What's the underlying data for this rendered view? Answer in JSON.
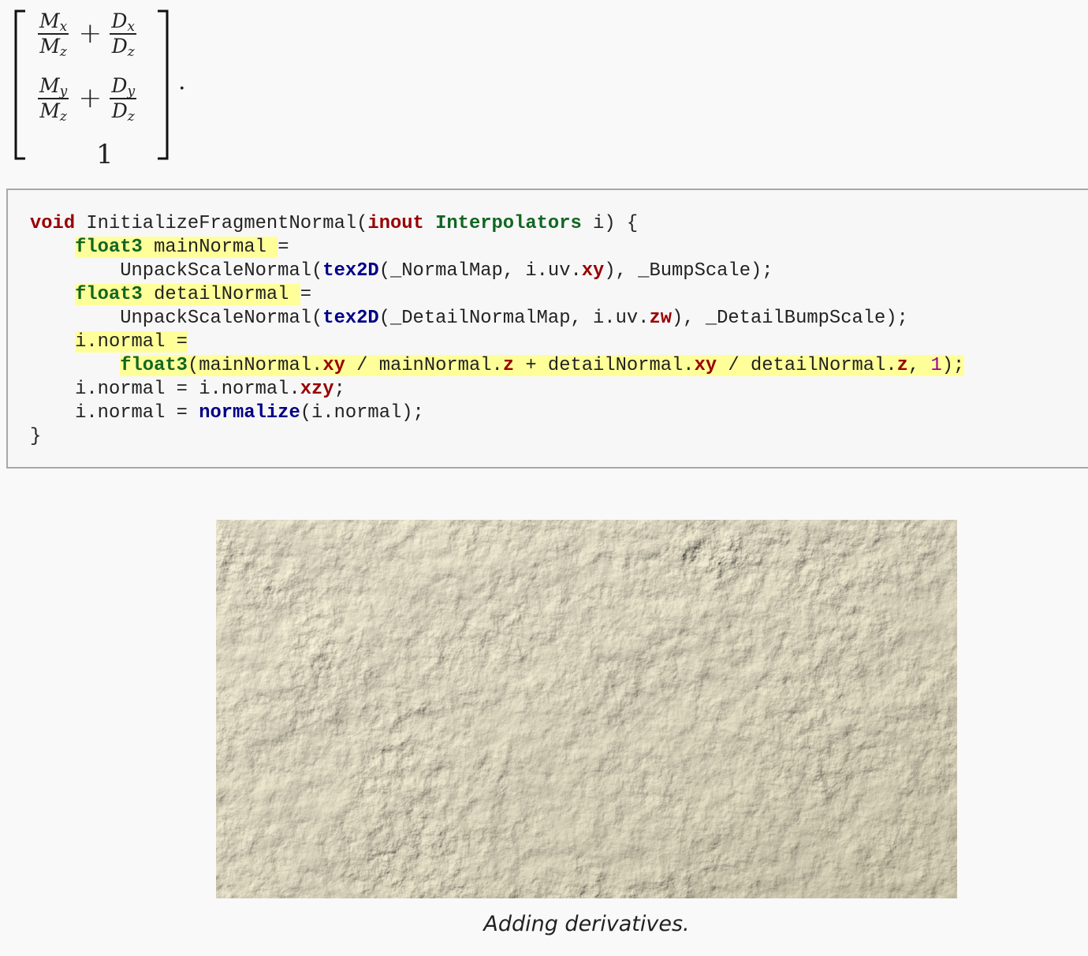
{
  "math": {
    "row1": {
      "n1": "M",
      "n1sub": "x",
      "d1": "M",
      "d1sub": "z",
      "op": "+",
      "n2": "D",
      "n2sub": "x",
      "d2": "D",
      "d2sub": "z"
    },
    "row2": {
      "n1": "M",
      "n1sub": "y",
      "d1": "M",
      "d1sub": "z",
      "op": "+",
      "n2": "D",
      "n2sub": "y",
      "d2": "D",
      "d2sub": "z"
    },
    "row3": "1",
    "terminator": "."
  },
  "code": {
    "lines": [
      [
        {
          "t": "void",
          "c": "kw"
        },
        {
          "t": " InitializeFragmentNormal("
        },
        {
          "t": "inout",
          "c": "kw"
        },
        {
          "t": " "
        },
        {
          "t": "Interpolators",
          "c": "ty"
        },
        {
          "t": " i) {"
        }
      ],
      [
        {
          "t": "    "
        },
        {
          "t": "float3",
          "c": "ty",
          "h": true
        },
        {
          "t": " mainNormal ",
          "h": true
        },
        {
          "t": "="
        }
      ],
      [
        {
          "t": "        UnpackScaleNormal("
        },
        {
          "t": "tex2D",
          "c": "fn"
        },
        {
          "t": "(_NormalMap, i.uv."
        },
        {
          "t": "xy",
          "c": "sw"
        },
        {
          "t": "), _BumpScale);"
        }
      ],
      [
        {
          "t": "    "
        },
        {
          "t": "float3",
          "c": "ty",
          "h": true
        },
        {
          "t": " detailNormal ",
          "h": true
        },
        {
          "t": "="
        }
      ],
      [
        {
          "t": "        UnpackScaleNormal("
        },
        {
          "t": "tex2D",
          "c": "fn"
        },
        {
          "t": "(_DetailNormalMap, i.uv."
        },
        {
          "t": "zw",
          "c": "sw"
        },
        {
          "t": "), _DetailBumpScale);"
        }
      ],
      [
        {
          "t": "    "
        },
        {
          "t": "i.normal =",
          "h": true
        }
      ],
      [
        {
          "t": "        "
        },
        {
          "t": "float3",
          "c": "ty",
          "h": true
        },
        {
          "t": "(mainNormal.",
          "h": true
        },
        {
          "t": "xy",
          "c": "sw",
          "h": true
        },
        {
          "t": " / mainNormal.",
          "h": true
        },
        {
          "t": "z",
          "c": "sw",
          "h": true
        },
        {
          "t": " + detailNormal.",
          "h": true
        },
        {
          "t": "xy",
          "c": "sw",
          "h": true
        },
        {
          "t": " / detailNormal.",
          "h": true
        },
        {
          "t": "z",
          "c": "sw",
          "h": true
        },
        {
          "t": ", ",
          "h": true
        },
        {
          "t": "1",
          "c": "nm",
          "h": true
        },
        {
          "t": ");",
          "h": true
        }
      ],
      [
        {
          "t": "    i.normal = i.normal."
        },
        {
          "t": "xzy",
          "c": "sw"
        },
        {
          "t": ";"
        }
      ],
      [
        {
          "t": "    i.normal = "
        },
        {
          "t": "normalize",
          "c": "fn"
        },
        {
          "t": "(i.normal);"
        }
      ],
      [
        {
          "t": "}"
        }
      ]
    ]
  },
  "figure": {
    "caption": "Adding derivatives.",
    "surface_color": "#e9e2c8"
  }
}
